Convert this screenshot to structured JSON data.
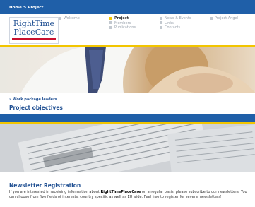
{
  "breadcrumb": {
    "home": "Home",
    "sep": " > ",
    "current": "Project"
  },
  "logo": {
    "line1": "RightTime",
    "line2": "PlaceCare"
  },
  "nav": {
    "col1": [
      "Welcome"
    ],
    "col2": [
      "Project",
      "Members",
      "Publications"
    ],
    "col3": [
      "News & Events",
      "Links",
      "Contacts"
    ],
    "col4": [
      "Project Angel"
    ],
    "active": "Project"
  },
  "main": {
    "link": "Work package leaders",
    "heading": "Project objectives"
  },
  "newsletter": {
    "title": "Newsletter Registration",
    "text_before": "If you are interested in receiving information about ",
    "brand": "RightTimePlaceCare",
    "text_after": " on a regular basis, please subscribe to our newsletters. You can choose from five fields of interests, country specific as well as EU wide. Feel free to register for several newsletters!"
  },
  "colors": {
    "brand_blue": "#1f5fa8",
    "accent_yellow": "#f2c500"
  }
}
